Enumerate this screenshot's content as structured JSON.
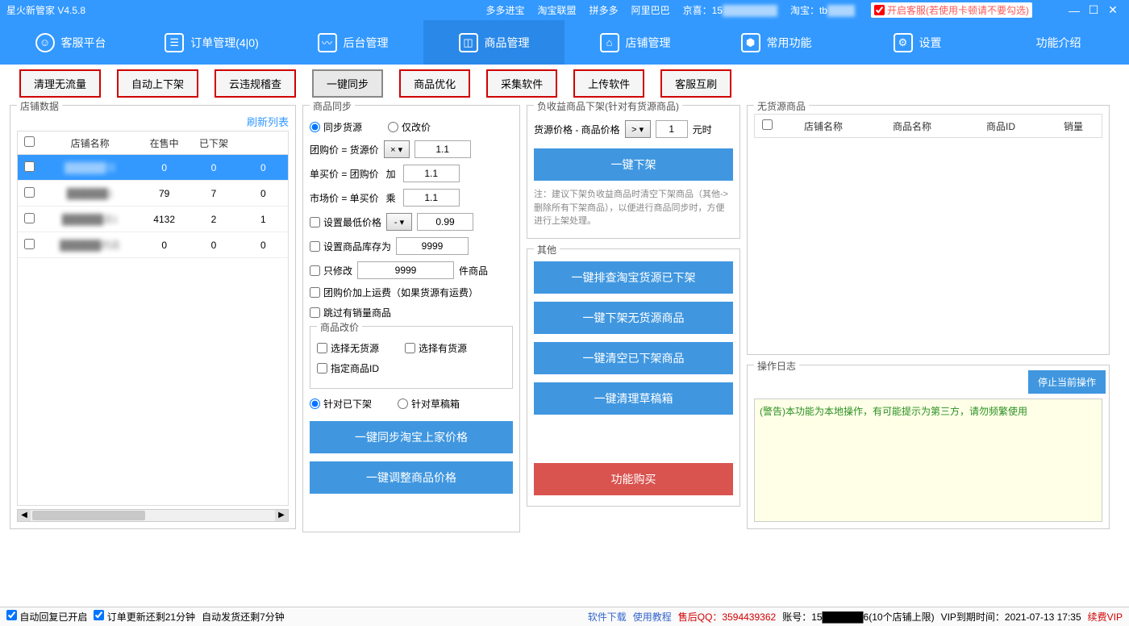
{
  "title": "星火新管家   V4.5.8",
  "topbar": {
    "links": [
      "多多进宝",
      "淘宝联盟",
      "拼多多",
      "阿里巴巴"
    ],
    "jd_label": "京喜：15",
    "jd_masked": "████████",
    "tb_label": "淘宝：tb",
    "tb_masked": "████",
    "cs_check": "开启客服(若使用卡顿请不要勾选)"
  },
  "nav": [
    {
      "icon": "☺",
      "label": "客服平台"
    },
    {
      "icon": "☰",
      "label": "订单管理(4|0)"
    },
    {
      "icon": "〰",
      "label": "后台管理"
    },
    {
      "icon": "◫",
      "label": "商品管理",
      "active": true
    },
    {
      "icon": "⌂",
      "label": "店铺管理"
    },
    {
      "icon": "⬢",
      "label": "常用功能"
    },
    {
      "icon": "⚙",
      "label": "设置"
    },
    {
      "icon": "",
      "label": "功能介绍"
    }
  ],
  "subtabs": [
    "清理无流量",
    "自动上下架",
    "云违规稽查",
    "一键同步",
    "商品优化",
    "采集软件",
    "上传软件",
    "客服互刷"
  ],
  "subtabs_active": 3,
  "left": {
    "title": "店铺数据",
    "refresh": "刷新列表",
    "headers": [
      "店铺名称",
      "在售中",
      "已下架"
    ],
    "rows": [
      {
        "name": "██████铺",
        "onsale": "0",
        "off": "0",
        "extra": "0",
        "sel": true
      },
      {
        "name": "██████1",
        "onsale": "79",
        "off": "7",
        "extra": "0"
      },
      {
        "name": "██████店1",
        "onsale": "4132",
        "off": "2",
        "extra": "1"
      },
      {
        "name": "██████的店",
        "onsale": "0",
        "off": "0",
        "extra": "0"
      }
    ]
  },
  "sync": {
    "title": "商品同步",
    "opt_source": "同步货源",
    "opt_price": "仅改价",
    "row1_label": "团购价 = 货源价",
    "row1_op": "× ▾",
    "row1_val": "1.1",
    "row2_label": "单买价 = 团购价",
    "row2_op": "加",
    "row2_val": "1.1",
    "row3_label": "市场价 = 单买价",
    "row3_op": "乘",
    "row3_val": "1.1",
    "min_price_label": "设置最低价格",
    "min_price_op": "- ▾",
    "min_price_val": "0.99",
    "stock_label": "设置商品库存为",
    "stock_val": "9999",
    "only_mod_label": "只修改",
    "only_mod_val": "9999",
    "only_mod_suffix": "件商品",
    "ship_label": "团购价加上运费（如果货源有运费）",
    "skip_sales_label": "跳过有销量商品",
    "mod_panel": "商品改价",
    "no_source": "选择无货源",
    "has_source": "选择有货源",
    "spec_id": "指定商品ID",
    "target_off": "针对已下架",
    "target_draft": "针对草稿箱",
    "btn_sync": "一键同步淘宝上家价格",
    "btn_adjust": "一键调整商品价格"
  },
  "neg": {
    "title": "负收益商品下架(针对有货源商品)",
    "price_label": "货源价格 - 商品价格",
    "op": "> ▾",
    "val": "1",
    "unit": "元时",
    "btn": "一键下架",
    "note": "注：建议下架负收益商品时清空下架商品（其他->删除所有下架商品），以便进行商品同步时，方便进行上架处理。"
  },
  "other": {
    "title": "其他",
    "b1": "一键排查淘宝货源已下架",
    "b2": "一键下架无货源商品",
    "b3": "一键清空已下架商品",
    "b4": "一键清理草稿箱",
    "buy": "功能购买"
  },
  "nosrc": {
    "title": "无货源商品",
    "headers": [
      "店铺名称",
      "商品名称",
      "商品ID",
      "销量"
    ]
  },
  "log": {
    "title": "操作日志",
    "stop": "停止当前操作",
    "line1": "(警告)本功能为本地操作，有可能提示为第三方，请勿频繁使用"
  },
  "status": {
    "auto_reply": "自动回复已开启",
    "order_update": "订单更新还剩21分钟",
    "auto_ship": "自动发货还剩7分钟",
    "dl": "软件下载",
    "tutorial": "使用教程",
    "qq": "售后QQ：3594439362",
    "acct": "账号：15██████6(10个店铺上限)",
    "vip_until": "VIP到期时间：2021-07-13 17:35",
    "renew": "续费VIP"
  }
}
